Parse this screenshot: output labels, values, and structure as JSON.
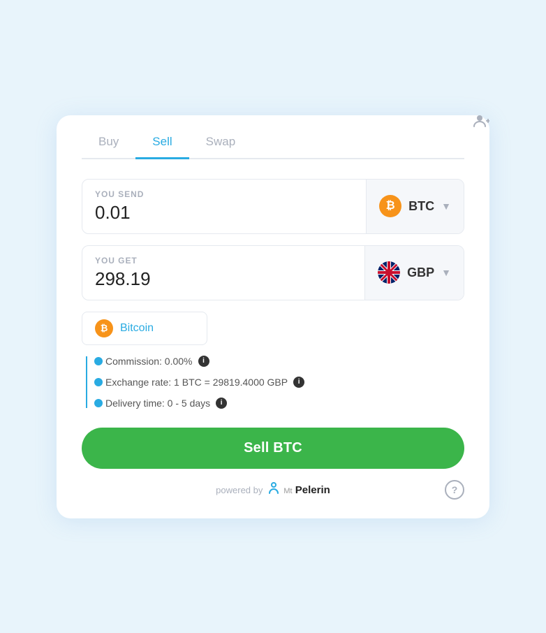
{
  "tabs": [
    {
      "label": "Buy",
      "active": false
    },
    {
      "label": "Sell",
      "active": true
    },
    {
      "label": "Swap",
      "active": false
    }
  ],
  "send_section": {
    "label": "YOU SEND",
    "value": "0.01",
    "currency_code": "BTC",
    "currency_icon": "₿"
  },
  "get_section": {
    "label": "YOU GET",
    "value": "298.19",
    "currency_code": "GBP"
  },
  "dropdown": {
    "label": "Bitcoin",
    "icon": "₿"
  },
  "info_rows": [
    {
      "text": "Commission: 0.00%",
      "has_info": true
    },
    {
      "text": "Exchange rate: 1 BTC = 29819.4000 GBP",
      "has_info": true
    },
    {
      "text": "Delivery time: 0 - 5 days",
      "has_info": true
    }
  ],
  "sell_button": {
    "label": "Sell BTC"
  },
  "footer": {
    "powered_by": "powered by",
    "brand": "Mt Pelerin",
    "help_label": "?"
  }
}
